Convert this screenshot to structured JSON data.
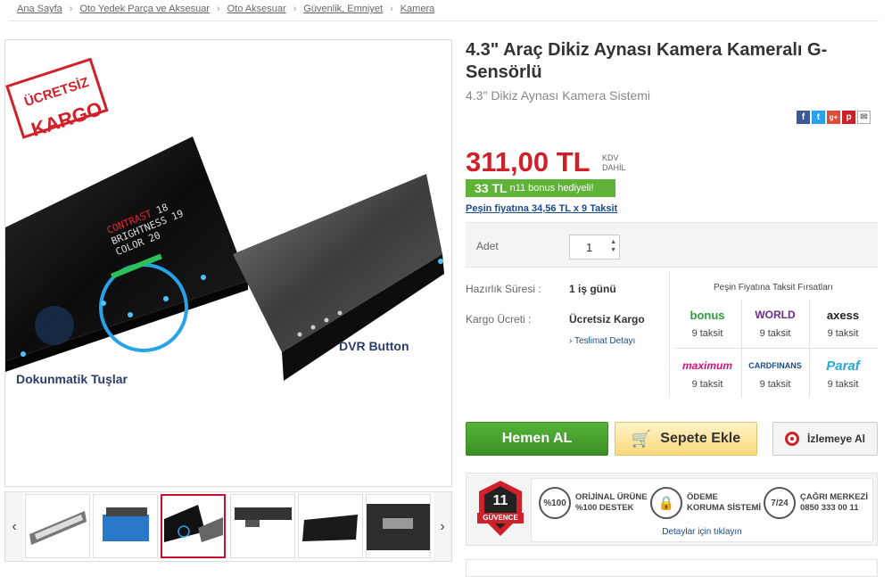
{
  "breadcrumb": [
    "Ana Sayfa",
    "Oto Yedek Parça ve Aksesuar",
    "Oto Aksesuar",
    "Güvenlik, Emniyet",
    "Kamera"
  ],
  "product": {
    "title": "4.3\" Araç Dikiz Aynası Kamera Kameralı G-Sensörlü",
    "subtitle": "4.3\" Dikiz Aynası Kamera Sistemi",
    "price": "311,00 TL",
    "kdv_line1": "KDV",
    "kdv_line2": "DAHİL",
    "bonus_amount": "33 TL",
    "bonus_text": "n11 bonus hediyeli!",
    "installment_link": "Peşin fiyatına 34,56 TL x 9 Taksit"
  },
  "image": {
    "badge_line1": "ÜCRETSİZ",
    "badge_line2": "KARGO",
    "screen_lines": [
      "CONTRAST",
      "BRIGHTNESS",
      "COLOR"
    ],
    "screen_values": [
      "18",
      "19",
      "20"
    ],
    "dvr_label": "DVR Button",
    "touch_label": "Dokunmatik Tuşlar"
  },
  "quantity": {
    "label": "Adet",
    "value": "1"
  },
  "info": {
    "prep_label": "Hazırlık Süresi :",
    "prep_value": "1 iş günü",
    "cargo_label": "Kargo Ücreti :",
    "cargo_value": "Ücretsiz Kargo",
    "delivery_link": "Teslimat Detayı"
  },
  "installments": {
    "title": "Peşin Fiyatına Taksit Fırsatları",
    "banks": [
      {
        "name": "bonus",
        "count": "9 taksit",
        "color": "#2e9e3e"
      },
      {
        "name": "WORLD",
        "count": "9 taksit",
        "color": "#6b2c8a"
      },
      {
        "name": "axess",
        "count": "9 taksit",
        "color": "#222222"
      },
      {
        "name": "maximum",
        "count": "9 taksit",
        "color": "#d4137c"
      },
      {
        "name": "CARDFINANS",
        "count": "9 taksit",
        "color": "#1b4c8c"
      },
      {
        "name": "Paraf",
        "count": "9 taksit",
        "color": "#2aa7d8"
      }
    ]
  },
  "buttons": {
    "buy": "Hemen AL",
    "cart": "Sepete Ekle",
    "watch": "İzlemeye Al"
  },
  "guvence": {
    "badge_number": "11",
    "badge_text": "GÜVENCE",
    "items": [
      {
        "icon": "%100",
        "line1": "ORİJİNAL ÜRÜNE",
        "line2": "%100 DESTEK"
      },
      {
        "icon": "lock-icon",
        "line1": "ÖDEME",
        "line2": "KORUMA SİSTEMİ"
      },
      {
        "icon": "7/24",
        "line1": "ÇAĞRI MERKEZİ",
        "line2": "0850 333 00 11"
      }
    ],
    "detail_link": "Detaylar için tıklayın"
  },
  "colors": {
    "price": "#d0212a",
    "bonus": "#5fb336",
    "link": "#1b4c8c",
    "buy": "#3b8e24"
  }
}
